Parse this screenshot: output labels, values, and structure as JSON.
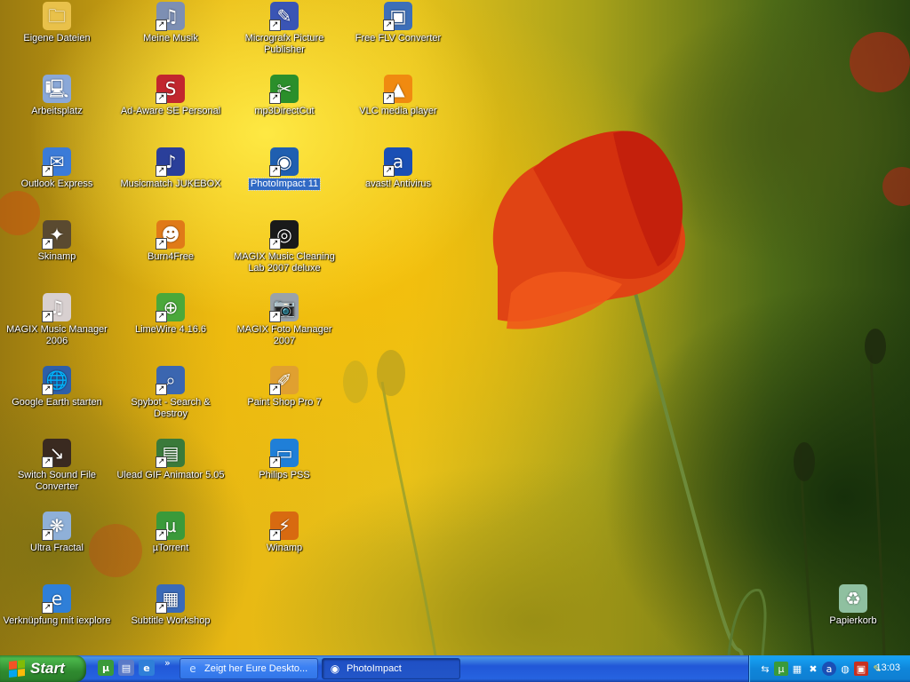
{
  "desktop": {
    "icons": [
      {
        "label": "Eigene Dateien",
        "icon": "folder-documents-icon",
        "color": "#e9c14a",
        "glyph": "🗀"
      },
      {
        "label": "Meine Musik",
        "icon": "music-folder-icon",
        "color": "#7d8fb3",
        "glyph": "♫"
      },
      {
        "label": "Micrografx Picture Publisher",
        "icon": "picture-publisher-icon",
        "color": "#3a55b5",
        "glyph": "✎"
      },
      {
        "label": "Free FLV Converter",
        "icon": "flv-converter-icon",
        "color": "#3d6fb8",
        "glyph": "▣"
      },
      {
        "label": "Arbeitsplatz",
        "icon": "my-computer-icon",
        "color": "#8aa8d8",
        "glyph": "🖳"
      },
      {
        "label": "Ad-Aware SE Personal",
        "icon": "ad-aware-icon",
        "color": "#c2262e",
        "glyph": "S"
      },
      {
        "label": "mp3DirectCut",
        "icon": "mp3directcut-icon",
        "color": "#2b8f2b",
        "glyph": "✂"
      },
      {
        "label": "VLC media player",
        "icon": "vlc-cone-icon",
        "color": "#f08a10",
        "glyph": "▲"
      },
      {
        "label": "Outlook Express",
        "icon": "outlook-express-icon",
        "color": "#3b7bd8",
        "glyph": "✉"
      },
      {
        "label": "Musicmatch JUKEBOX",
        "icon": "musicmatch-icon",
        "color": "#2a3f9a",
        "glyph": "♪"
      },
      {
        "label": "PhotoImpact 11",
        "icon": "photoimpact-icon",
        "color": "#1f5fb0",
        "glyph": "◉"
      },
      {
        "label": "avast! Antivirus",
        "icon": "avast-icon",
        "color": "#1a4fb5",
        "glyph": "a"
      },
      {
        "label": "Skinamp",
        "icon": "skinamp-icon",
        "color": "#5a4a30",
        "glyph": "✦"
      },
      {
        "label": "Burn4Free",
        "icon": "burn4free-icon",
        "color": "#e07a18",
        "glyph": "☻"
      },
      {
        "label": "MAGIX Music Cleaning Lab 2007 deluxe",
        "icon": "magix-cleaning-lab-icon",
        "color": "#1a1a1a",
        "glyph": "◎"
      },
      {
        "label": "MAGIX Music Manager 2006",
        "icon": "magix-music-manager-icon",
        "color": "#d8d0d0",
        "glyph": "♫"
      },
      {
        "label": "LimeWire 4.16.6",
        "icon": "limewire-icon",
        "color": "#4aa83a",
        "glyph": "⊕"
      },
      {
        "label": "MAGIX Foto Manager 2007",
        "icon": "magix-foto-manager-icon",
        "color": "#9aa2a8",
        "glyph": "📷"
      },
      {
        "label": "Google Earth starten",
        "icon": "google-earth-icon",
        "color": "#2e5fa8",
        "glyph": "🌐"
      },
      {
        "label": "Spybot - Search & Destroy",
        "icon": "spybot-icon",
        "color": "#3b66b0",
        "glyph": "⌕"
      },
      {
        "label": "Paint Shop Pro 7",
        "icon": "paint-shop-pro-icon",
        "color": "#e0a030",
        "glyph": "✐"
      },
      {
        "label": "Switch Sound File Converter",
        "icon": "switch-converter-icon",
        "color": "#3a2a20",
        "glyph": "↘"
      },
      {
        "label": "Ulead GIF Animator 5.05",
        "icon": "gif-animator-icon",
        "color": "#3a7a3a",
        "glyph": "▤"
      },
      {
        "label": "Philips PSS",
        "icon": "philips-pss-icon",
        "color": "#1f7fd8",
        "glyph": "▭"
      },
      {
        "label": "Ultra Fractal",
        "icon": "ultra-fractal-icon",
        "color": "#8fb0d8",
        "glyph": "❋"
      },
      {
        "label": "µTorrent",
        "icon": "utorrent-icon",
        "color": "#3a9a3a",
        "glyph": "µ"
      },
      {
        "label": "Winamp",
        "icon": "winamp-icon",
        "color": "#d86a10",
        "glyph": "⚡"
      },
      {
        "label": "Verknüpfung mit iexplore",
        "icon": "internet-explorer-icon",
        "color": "#2f7fd8",
        "glyph": "e"
      },
      {
        "label": "Subtitle Workshop",
        "icon": "subtitle-workshop-icon",
        "color": "#3a6ab8",
        "glyph": "▦"
      },
      {
        "label": "Papierkorb",
        "icon": "recycle-bin-icon",
        "color": "#8fc0a0",
        "glyph": "♻"
      }
    ],
    "selected_icon": "PhotoImpact 11"
  },
  "taskbar": {
    "start_label": "Start",
    "quick_launch": [
      {
        "icon": "utorrent-quicklaunch-icon",
        "color": "#3a9a3a",
        "glyph": "µ"
      },
      {
        "icon": "show-desktop-icon",
        "color": "#5a7ac8",
        "glyph": "▤"
      },
      {
        "icon": "internet-explorer-quicklaunch-icon",
        "color": "#2f7fd8",
        "glyph": "e"
      }
    ],
    "more_label": "»",
    "tasks": [
      {
        "label": "Zeigt her Eure Deskto...",
        "icon": "internet-explorer-icon",
        "glyph": "e",
        "active": false
      },
      {
        "label": "PhotoImpact",
        "icon": "photoimpact-icon",
        "glyph": "◉",
        "active": true
      }
    ],
    "tray": {
      "icons": [
        {
          "icon": "network-icon",
          "glyph": "⇆"
        },
        {
          "icon": "utorrent-tray-icon",
          "glyph": "µ"
        },
        {
          "icon": "network-connection-icon",
          "glyph": "▦"
        },
        {
          "icon": "security-icon",
          "glyph": "✖"
        },
        {
          "icon": "avast-tray-icon",
          "glyph": "a"
        },
        {
          "icon": "volume-icon",
          "glyph": "◍"
        },
        {
          "icon": "display-icon",
          "glyph": "▣"
        },
        {
          "icon": "pencil-icon",
          "glyph": "✎"
        }
      ],
      "clock": "13:03"
    }
  }
}
